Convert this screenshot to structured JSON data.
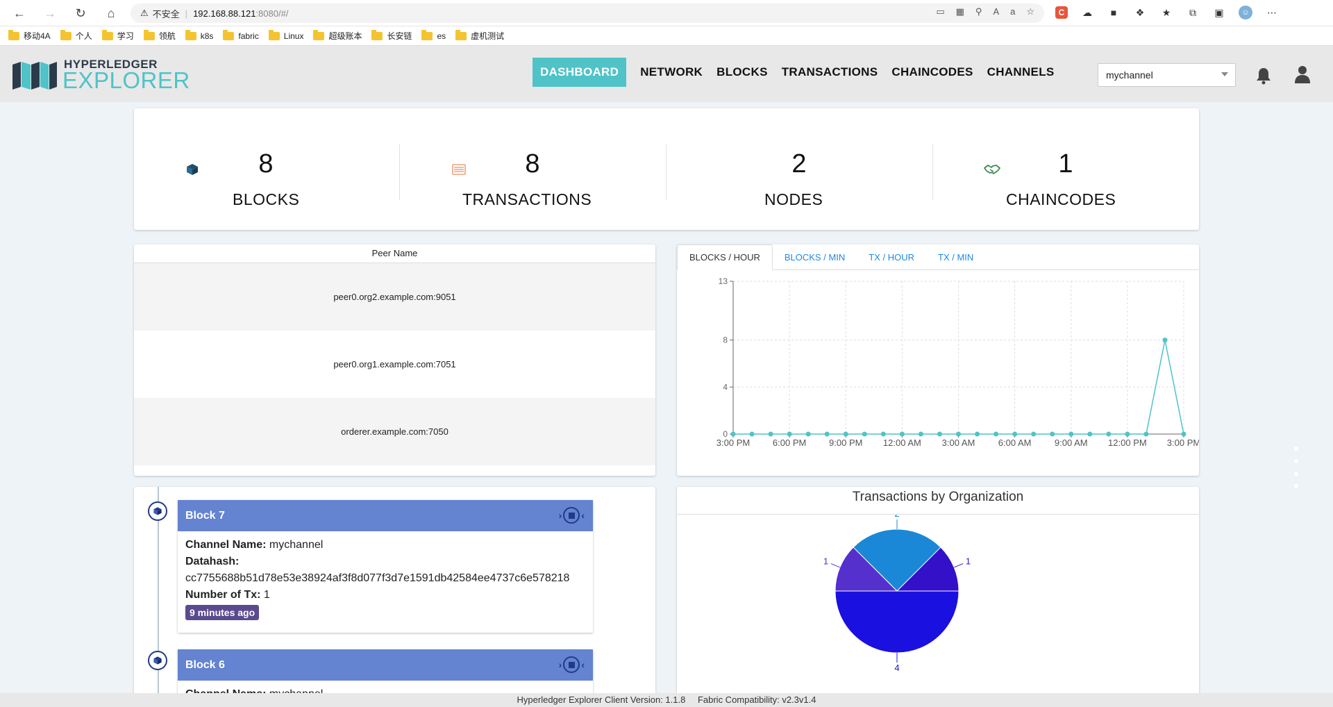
{
  "browser": {
    "insecure_label": "不安全",
    "url_host": "192.168.88.121",
    "url_path": ":8080/#/",
    "bookmarks": [
      "移动4A",
      "个人",
      "学习",
      "领航",
      "k8s",
      "fabric",
      "Linux",
      "超级账本",
      "长安链",
      "es",
      "虚机测试"
    ]
  },
  "header": {
    "logo_top": "HYPERLEDGER",
    "logo_bottom": "EXPLORER",
    "nav": [
      "DASHBOARD",
      "NETWORK",
      "BLOCKS",
      "TRANSACTIONS",
      "CHAINCODES",
      "CHANNELS"
    ],
    "active_nav": "DASHBOARD",
    "channel": "mychannel"
  },
  "stats": [
    {
      "value": "8",
      "label": "BLOCKS",
      "icon": "cube-icon",
      "color": "#b7d7e8"
    },
    {
      "value": "8",
      "label": "TRANSACTIONS",
      "icon": "list-icon",
      "color": "#fde0d0"
    },
    {
      "value": "2",
      "label": "NODES",
      "icon": "users-icon",
      "color": "#5c6784"
    },
    {
      "value": "1",
      "label": "CHAINCODES",
      "icon": "handshake-icon",
      "color": "#d3eed9"
    }
  ],
  "peers": {
    "header": "Peer Name",
    "rows": [
      "peer0.org2.example.com:9051",
      "peer0.org1.example.com:7051",
      "orderer.example.com:7050"
    ]
  },
  "metrics_tabs": [
    "BLOCKS / HOUR",
    "BLOCKS / MIN",
    "TX / HOUR",
    "TX / MIN"
  ],
  "chart_data": {
    "type": "line",
    "title": "",
    "xlabel": "",
    "ylabel": "",
    "ylim": [
      0,
      13
    ],
    "yticks": [
      0,
      4,
      8,
      13
    ],
    "xtick_labels": [
      "3:00 PM",
      "6:00 PM",
      "9:00 PM",
      "12:00 AM",
      "3:00 AM",
      "6:00 AM",
      "9:00 AM",
      "12:00 PM",
      "3:00 PM"
    ],
    "x": [
      0,
      1,
      2,
      3,
      4,
      5,
      6,
      7,
      8,
      9,
      10,
      11,
      12,
      13,
      14,
      15,
      16,
      17,
      18,
      19,
      20,
      21,
      22,
      23,
      24
    ],
    "series": [
      {
        "values": [
          0,
          0,
          0,
          0,
          0,
          0,
          0,
          0,
          0,
          0,
          0,
          0,
          0,
          0,
          0,
          0,
          0,
          0,
          0,
          0,
          0,
          0,
          0,
          8,
          0
        ],
        "color": "#4fc3c8"
      }
    ],
    "grid": true
  },
  "blocks": [
    {
      "title": "Block 7",
      "channel_label": "Channel Name:",
      "channel": "mychannel",
      "datahash_label": "Datahash:",
      "datahash": "cc7755688b51d78e53e38924af3f8d077f3d7e1591db42584ee4737c6e578218",
      "ntx_label": "Number of Tx:",
      "ntx": "1",
      "time": "9 minutes ago"
    },
    {
      "title": "Block 6",
      "channel_label": "Channel Name:",
      "channel": "mychannel"
    }
  ],
  "org_chart": {
    "title": "Transactions by Organization",
    "type": "pie",
    "slices": [
      {
        "value": 2,
        "label": "2",
        "color": "#1a88d6"
      },
      {
        "value": 1,
        "label": "1",
        "color": "#3410c8"
      },
      {
        "value": 4,
        "label": "4",
        "color": "#1a10e0"
      },
      {
        "value": 1,
        "label": "1",
        "color": "#5530cc"
      }
    ]
  },
  "footer": {
    "version": "Hyperledger Explorer Client Version: 1.1.8",
    "compat": "Fabric Compatibility: v2.3v1.4"
  }
}
